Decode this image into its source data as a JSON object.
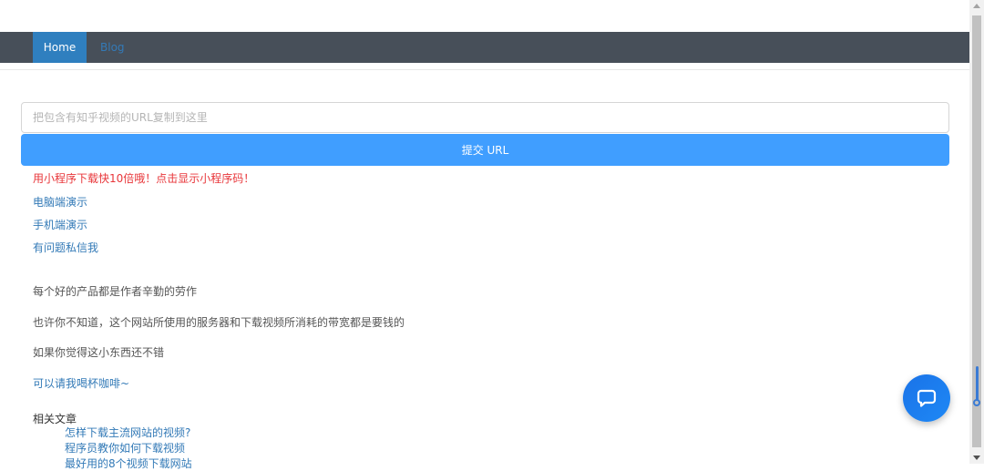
{
  "nav": {
    "home_label": "Home",
    "blog_label": "Blog"
  },
  "form": {
    "url_placeholder": "把包含有知乎视频的URL复制到这里",
    "url_value": "",
    "submit_label": "提交 URL"
  },
  "links": {
    "miniprogram": "用小程序下载快10倍哦！点击显示小程序码！",
    "pc_demo": "电脑端演示",
    "mobile_demo": "手机端演示",
    "contact": "有问题私信我"
  },
  "donation": {
    "line1": "每个好的产品都是作者辛勤的劳作",
    "line2": "也许你不知道，这个网站所使用的服务器和下载视频所消耗的带宽都是要钱的",
    "line3": "如果你觉得这小东西还不错",
    "coffee_link": "可以请我喝杯咖啡~"
  },
  "related": {
    "heading": "相关文章",
    "items": [
      "怎样下载主流网站的视频?",
      "程序员教你如何下载视频",
      "最好用的8个视频下载网站"
    ]
  },
  "chat": {
    "icon": "chat-bubble-icon"
  },
  "colors": {
    "navbar": "#474f59",
    "active_nav": "#2f7fbf",
    "submit_button": "#409eff",
    "link": "#337ab7",
    "alert_text": "#e8363a",
    "chat_button": "#1a73e8"
  }
}
